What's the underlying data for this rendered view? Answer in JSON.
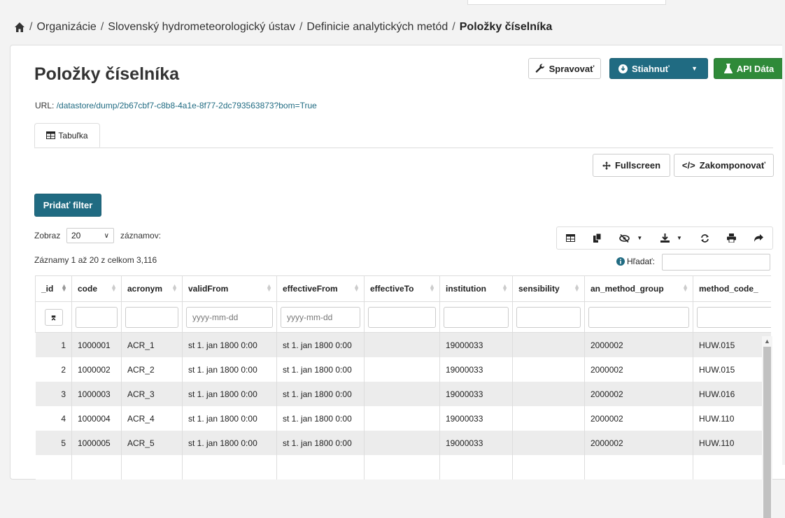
{
  "breadcrumb": {
    "items": [
      "Organizácie",
      "Slovenský hydrometeorologický ústav",
      "Definicie analytických metód"
    ],
    "current": "Položky číselníka",
    "separator": "/"
  },
  "page": {
    "title": "Položky číselníka",
    "url_label": "URL:",
    "url_value": "/datastore/dump/2b67cbf7-c8b8-4a1e-8f77-2dc793563873?bom=True"
  },
  "actions": {
    "manage": "Spravovať",
    "download": "Stiahnuť",
    "api": "API Dáta"
  },
  "tab": {
    "label": "Tabuľka"
  },
  "view_buttons": {
    "fullscreen": "Fullscreen",
    "embed": "Zakomponovať"
  },
  "filter_button": "Pridať filter",
  "length": {
    "prefix": "Zobraz",
    "value": "20",
    "suffix": "záznamov:"
  },
  "info": "Záznamy 1 až 20 z celkom 3,116",
  "search": {
    "label": "Hľadať:"
  },
  "table": {
    "columns": [
      "_id",
      "code",
      "acronym",
      "validFrom",
      "effectiveFrom",
      "effectiveTo",
      "institution",
      "sensibility",
      "an_method_group",
      "method_code_"
    ],
    "date_placeholder": "yyyy-mm-dd",
    "rows": [
      [
        "1",
        "1000001",
        "ACR_1",
        "st 1. jan 1800 0:00",
        "st 1. jan 1800 0:00",
        "",
        "19000033",
        "",
        "2000002",
        "HUW.015"
      ],
      [
        "2",
        "1000002",
        "ACR_2",
        "st 1. jan 1800 0:00",
        "st 1. jan 1800 0:00",
        "",
        "19000033",
        "",
        "2000002",
        "HUW.015"
      ],
      [
        "3",
        "1000003",
        "ACR_3",
        "st 1. jan 1800 0:00",
        "st 1. jan 1800 0:00",
        "",
        "19000033",
        "",
        "2000002",
        "HUW.016"
      ],
      [
        "4",
        "1000004",
        "ACR_4",
        "st 1. jan 1800 0:00",
        "st 1. jan 1800 0:00",
        "",
        "19000033",
        "",
        "2000002",
        "HUW.110"
      ],
      [
        "5",
        "1000005",
        "ACR_5",
        "st 1. jan 1800 0:00",
        "st 1. jan 1800 0:00",
        "",
        "19000033",
        "",
        "2000002",
        "HUW.110"
      ],
      [
        "",
        "",
        "",
        "",
        "",
        "",
        "",
        "",
        "",
        ""
      ]
    ]
  },
  "colors": {
    "teal": "#206b82",
    "green": "#2f8a39",
    "link": "#206b82"
  },
  "icons": [
    "home-icon",
    "wrench-icon",
    "download-circle-icon",
    "flask-icon",
    "table-icon",
    "move-icon",
    "code-icon",
    "columns-icon",
    "copy-icon",
    "eye-slash-icon",
    "download-icon",
    "refresh-icon",
    "print-icon",
    "share-icon",
    "info-icon",
    "caret-down-icon",
    "column-filter-icon"
  ]
}
